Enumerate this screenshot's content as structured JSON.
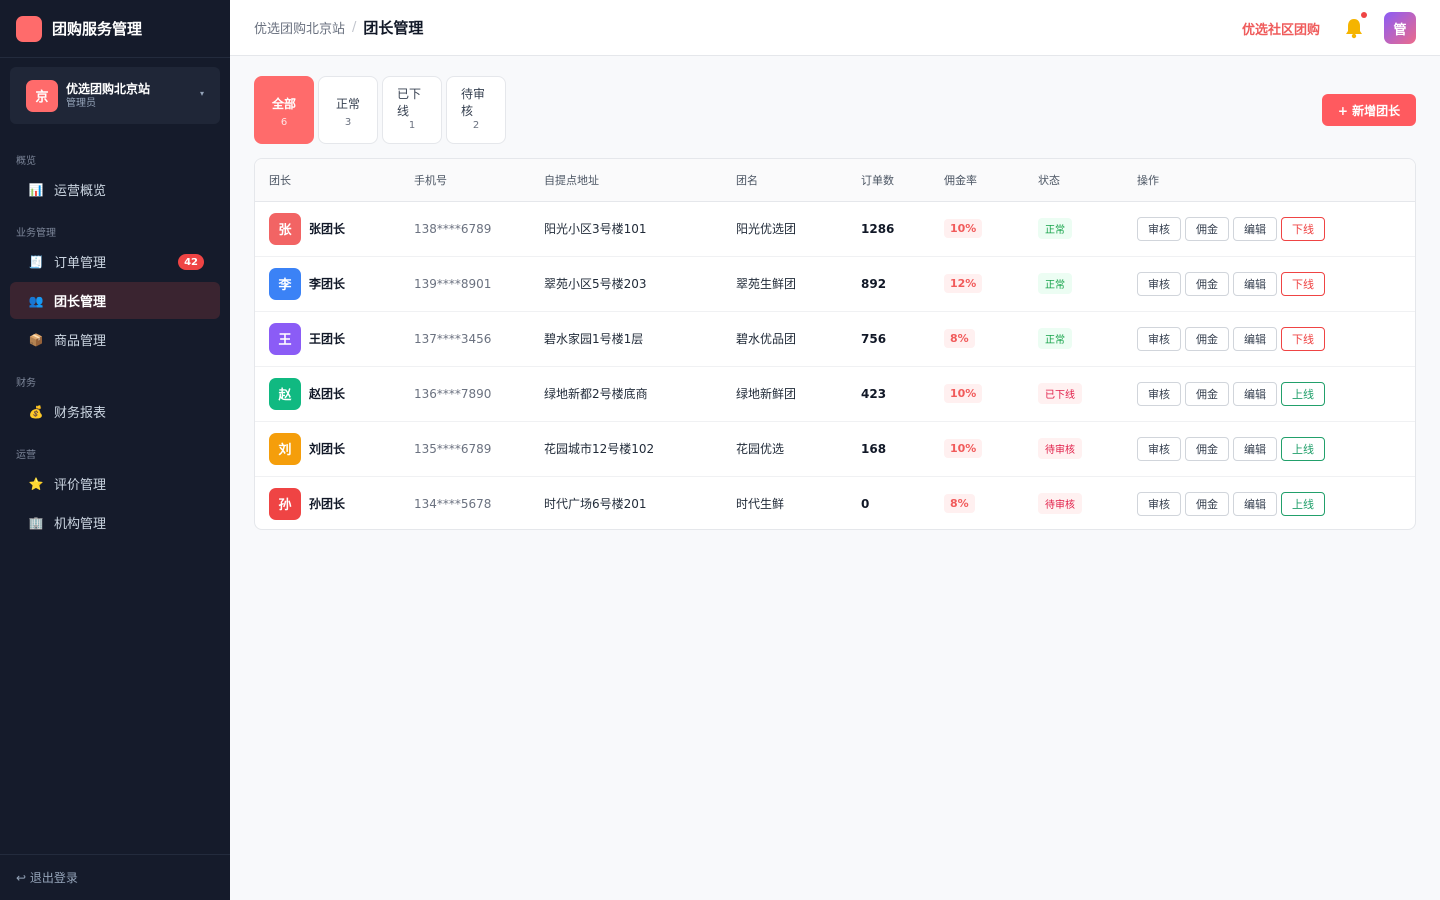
{
  "brand": {
    "title": "团购服务管理"
  },
  "org": {
    "avatar": "京",
    "name": "优选团购北京站",
    "role": "管理员",
    "caret": "▾"
  },
  "nav": {
    "groups": [
      "概览",
      "业务管理",
      "财务",
      "运营"
    ],
    "items": [
      {
        "label": "运营概览",
        "icon": "bar-chart-icon",
        "glyph": "📊"
      },
      {
        "label": "订单管理",
        "icon": "receipt-icon",
        "glyph": "🧾",
        "badge": "42"
      },
      {
        "label": "团长管理",
        "icon": "users-icon",
        "glyph": "👥"
      },
      {
        "label": "商品管理",
        "icon": "package-icon",
        "glyph": "📦"
      },
      {
        "label": "财务报表",
        "icon": "money-bag-icon",
        "glyph": "💰"
      },
      {
        "label": "评价管理",
        "icon": "star-icon",
        "glyph": "⭐"
      },
      {
        "label": "机构管理",
        "icon": "building-icon",
        "glyph": "🏢"
      }
    ],
    "active": "团长管理"
  },
  "logout": {
    "label": "↩ 退出登录"
  },
  "header": {
    "breadcrumb_parent": "优选团购北京站",
    "breadcrumb_sep": "/",
    "title": "团长管理",
    "link": "优选社区团购",
    "user_avatar": "管"
  },
  "tabs": [
    {
      "label": "全部",
      "count": "6",
      "active": true
    },
    {
      "label": "正常",
      "count": "3"
    },
    {
      "label": "已下线",
      "count": "1"
    },
    {
      "label": "待审核",
      "count": "2"
    }
  ],
  "add_button": "+ 新增团长",
  "table": {
    "headers": [
      "团长",
      "手机号",
      "自提点地址",
      "团名",
      "订单数",
      "佣金率",
      "状态",
      "操作"
    ],
    "actions": [
      "审核",
      "佣金",
      "编辑"
    ],
    "rows": [
      {
        "avatar": "张",
        "color": "#f26464",
        "name": "张团长",
        "phone": "138****6789",
        "address": "阳光小区3号楼101",
        "group": "阳光优选团",
        "orders": "1286",
        "rate": "10%",
        "status": "正常",
        "status_type": "normal",
        "toggle": "下线"
      },
      {
        "avatar": "李",
        "color": "#3b82f6",
        "name": "李团长",
        "phone": "139****8901",
        "address": "翠苑小区5号楼203",
        "group": "翠苑生鲜团",
        "orders": "892",
        "rate": "12%",
        "status": "正常",
        "status_type": "normal",
        "toggle": "下线"
      },
      {
        "avatar": "王",
        "color": "#8b5cf6",
        "name": "王团长",
        "phone": "137****3456",
        "address": "碧水家园1号楼1层",
        "group": "碧水优品团",
        "orders": "756",
        "rate": "8%",
        "status": "正常",
        "status_type": "normal",
        "toggle": "下线"
      },
      {
        "avatar": "赵",
        "color": "#10b981",
        "name": "赵团长",
        "phone": "136****7890",
        "address": "绿地新都2号楼底商",
        "group": "绿地新鲜团",
        "orders": "423",
        "rate": "10%",
        "status": "已下线",
        "status_type": "offline",
        "toggle": "上线"
      },
      {
        "avatar": "刘",
        "color": "#f59e0b",
        "name": "刘团长",
        "phone": "135****6789",
        "address": "花园城市12号楼102",
        "group": "花园优选",
        "orders": "168",
        "rate": "10%",
        "status": "待审核",
        "status_type": "pending",
        "toggle": "上线"
      },
      {
        "avatar": "孙",
        "color": "#ef4444",
        "name": "孙团长",
        "phone": "134****5678",
        "address": "时代广场6号楼201",
        "group": "时代生鲜",
        "orders": "0",
        "rate": "8%",
        "status": "待审核",
        "status_type": "pending",
        "toggle": "上线"
      }
    ]
  },
  "colors": {
    "accent": "#ff6b6b",
    "sidebar_bg": "#151b2b",
    "active_nav_bg": "#3a2430"
  }
}
